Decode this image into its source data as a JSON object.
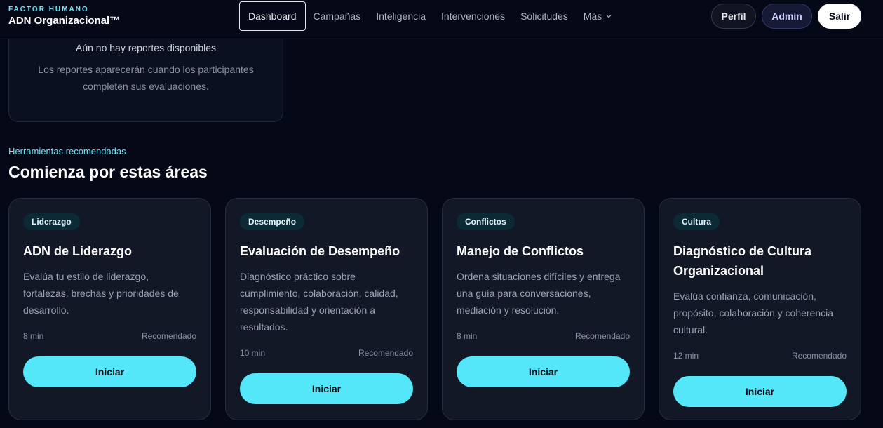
{
  "brand": {
    "kicker": "FACTOR HUMANO",
    "title": "ADN Organizacional™"
  },
  "nav": {
    "items": [
      {
        "label": "Dashboard",
        "active": true
      },
      {
        "label": "Campañas"
      },
      {
        "label": "Inteligencia"
      },
      {
        "label": "Intervenciones"
      },
      {
        "label": "Solicitudes"
      },
      {
        "label": "Más"
      }
    ]
  },
  "header_actions": {
    "perfil": "Perfil",
    "admin": "Admin",
    "salir": "Salir"
  },
  "reports_empty": {
    "title": "Aún no hay reportes disponibles",
    "text": "Los reportes aparecerán cuando los participantes completen sus evaluaciones."
  },
  "tools": {
    "kicker": "Herramientas recomendadas",
    "title": "Comienza por estas áreas",
    "cards": [
      {
        "tag": "Liderazgo",
        "title": "ADN de Liderazgo",
        "description": "Evalúa tu estilo de liderazgo, fortalezas, brechas y prioridades de desarrollo.",
        "duration": "8 min",
        "recommendation": "Recomendado",
        "button": "Iniciar"
      },
      {
        "tag": "Desempeño",
        "title": "Evaluación de Desempeño",
        "description": "Diagnóstico práctico sobre cumplimiento, colaboración, calidad, responsabilidad y orientación a resultados.",
        "duration": "10 min",
        "recommendation": "Recomendado",
        "button": "Iniciar"
      },
      {
        "tag": "Conflictos",
        "title": "Manejo de Conflictos",
        "description": "Ordena situaciones difíciles y entrega una guía para conversaciones, mediación y resolución.",
        "duration": "8 min",
        "recommendation": "Recomendado",
        "button": "Iniciar"
      },
      {
        "tag": "Cultura",
        "title": "Diagnóstico de Cultura Organizacional",
        "description": "Evalúa confianza, comunicación, propósito, colaboración y coherencia cultural.",
        "duration": "12 min",
        "recommendation": "Recomendado",
        "button": "Iniciar"
      }
    ]
  },
  "colors": {
    "background": "#050816",
    "accent": "#53e7f9",
    "card": "#121826",
    "kicker": "#67e8f9"
  }
}
